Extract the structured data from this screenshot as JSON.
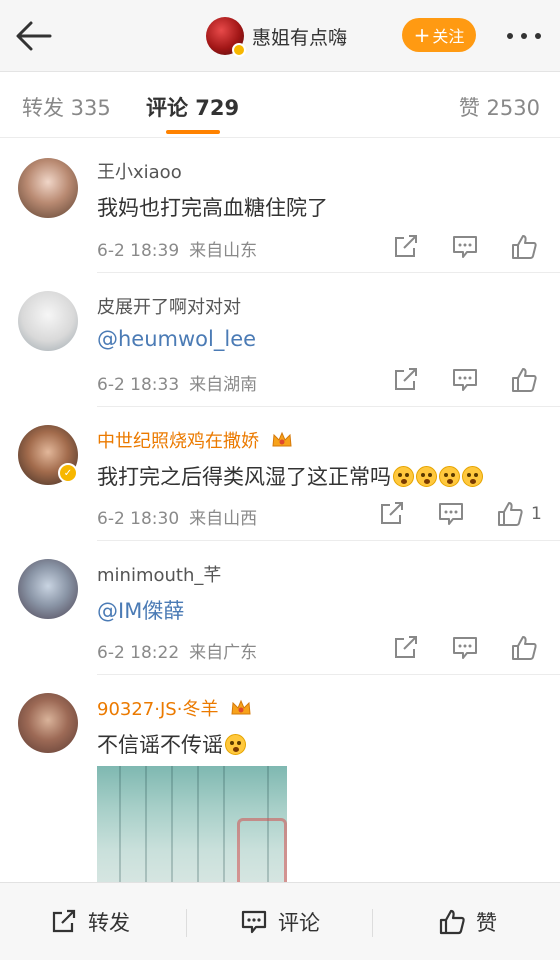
{
  "header": {
    "author_name": "惠姐有点嗨",
    "follow_label": "关注",
    "follow_plus": "+",
    "accent_color": "#ff9a12"
  },
  "tabs": {
    "repost_label": "转发 335",
    "comments_label": "评论 729",
    "likes_label": "赞 2530",
    "active": "comments",
    "underline_color": "#ff8200"
  },
  "comments": [
    {
      "name": "王小xiaoo",
      "text": "我妈也打完高血糖住院了",
      "time": "6-2 18:39",
      "location": "来自山东",
      "likes": "",
      "vip": false
    },
    {
      "name": "皮展开了啊对对对",
      "text": "@heumwol_lee",
      "time": "6-2 18:33",
      "location": "来自湖南",
      "likes": "",
      "vip": false
    },
    {
      "name": "中世纪照烧鸡在撒娇",
      "text": "我打完之后得类风湿了这正常吗",
      "time": "6-2 18:30",
      "location": "来自山西",
      "likes": "1",
      "vip": true
    },
    {
      "name": "minimouth_芊",
      "text": "@IM傑薛",
      "time": "6-2 18:22",
      "location": "来自广东",
      "likes": "",
      "vip": false
    },
    {
      "name": "90327·JS·冬羊",
      "text": "不信谣不传谣",
      "time": "",
      "location": "",
      "likes": "",
      "vip": true
    }
  ],
  "icons": {
    "back": "back-arrow-icon",
    "more": "more-dots-icon",
    "repost": "repost-icon",
    "comment": "comment-icon",
    "like": "thumbs-up-icon",
    "crown": "crown-icon",
    "verified": "verified-badge-icon",
    "emoji": "astonished-face-emoji"
  },
  "bottom_bar": {
    "repost_label": "转发",
    "comment_label": "评论",
    "like_label": "赞"
  }
}
